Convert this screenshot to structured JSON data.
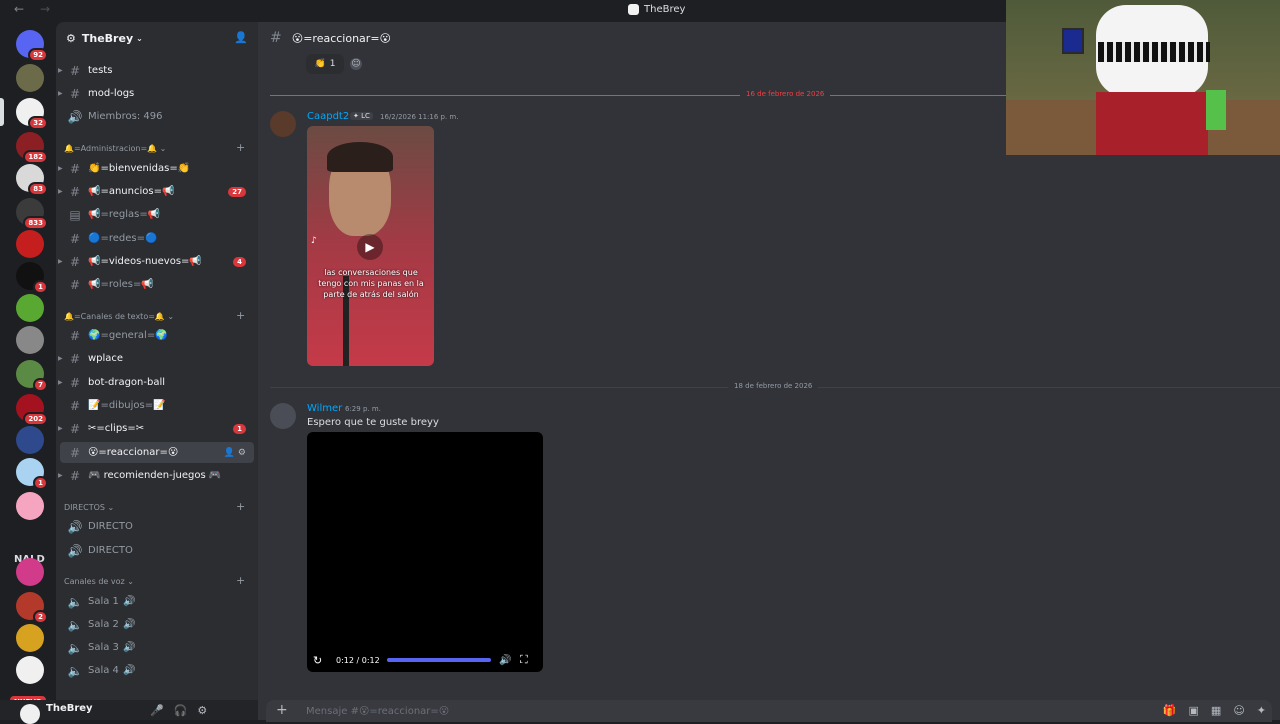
{
  "window": {
    "title": "TheBrey",
    "back": "←",
    "forward": "→"
  },
  "rail": {
    "servers": [
      {
        "badge": "92"
      },
      {
        "badge": ""
      },
      {
        "badge": "32"
      },
      {
        "badge": "182"
      },
      {
        "badge": "83"
      },
      {
        "badge": "833"
      },
      {
        "badge": ""
      },
      {
        "badge": "1"
      },
      {
        "badge": ""
      },
      {
        "badge": ""
      },
      {
        "badge": "7"
      },
      {
        "badge": "202"
      },
      {
        "badge": ""
      },
      {
        "badge": "1"
      },
      {
        "badge": ""
      },
      {
        "badge": ""
      },
      {
        "badge": "2"
      },
      {
        "badge": ""
      },
      {
        "badge": ""
      }
    ],
    "folder_label": "NALD",
    "new_label": "NUEVO"
  },
  "sidebar": {
    "server_name": "TheBrey",
    "channels": [
      {
        "label": "tests",
        "count": ""
      },
      {
        "label": "mod-logs",
        "count": ""
      },
      {
        "label": "Miembros: 496",
        "count": ""
      },
      {
        "label": "👏=bienvenidas=👏",
        "count": ""
      },
      {
        "label": "📢=anuncios=📢",
        "count": "27"
      },
      {
        "label": "📢=reglas=📢",
        "count": ""
      },
      {
        "label": "🔵=redes=🔵",
        "count": ""
      },
      {
        "label": "📢=videos-nuevos=📢",
        "count": "4"
      },
      {
        "label": "📢=roles=📢",
        "count": ""
      },
      {
        "label": "🌍=general=🌍",
        "count": ""
      },
      {
        "label": "wplace",
        "count": ""
      },
      {
        "label": "bot-dragon-ball",
        "count": ""
      },
      {
        "label": "📝=dibujos=📝",
        "count": ""
      },
      {
        "label": "✂=clips=✂",
        "count": "1"
      },
      {
        "label": "😮=reaccionar=😮",
        "count": ""
      },
      {
        "label": "🎮 recomienden-juegos 🎮",
        "count": ""
      },
      {
        "label": "DIRECTO",
        "count": ""
      },
      {
        "label": "DIRECTO",
        "count": ""
      },
      {
        "label": "Sala 1",
        "count": ""
      },
      {
        "label": "Sala 2",
        "count": ""
      },
      {
        "label": "Sala 3",
        "count": ""
      },
      {
        "label": "Sala 4",
        "count": ""
      }
    ],
    "categories": [
      "🔔=Administracion=🔔",
      "🔔=Canales de texto=🔔",
      "DIRECTOS",
      "Canales de voz"
    ]
  },
  "user": {
    "name": "TheBrey"
  },
  "chat": {
    "channel_name": "😮=reaccionar=😮",
    "reaction": {
      "emoji": "👏",
      "count": "1"
    },
    "dividers": [
      "16 de febrero de 2026",
      "18 de febrero de 2026"
    ],
    "messages": [
      {
        "author": "Caapdt2",
        "tag": "✦ LC",
        "time": "16/2/2026 11:16 p. m.",
        "text": "",
        "video_caption": "las conversaciones que tengo con mis panas en la parte de atrás del salón"
      },
      {
        "author": "Wilmer",
        "tag": "",
        "time": "6:29 p. m.",
        "text": "Espero que te guste breyy",
        "video_time": "0:12 / 0:12",
        "video_progress": 1.0
      }
    ],
    "composer_placeholder": "Mensaje #😮=reaccionar=😮"
  },
  "colors": {
    "accent": "#5865f2",
    "badge": "#da373c",
    "author": "#00a8fc",
    "divider": "#f23f43"
  }
}
